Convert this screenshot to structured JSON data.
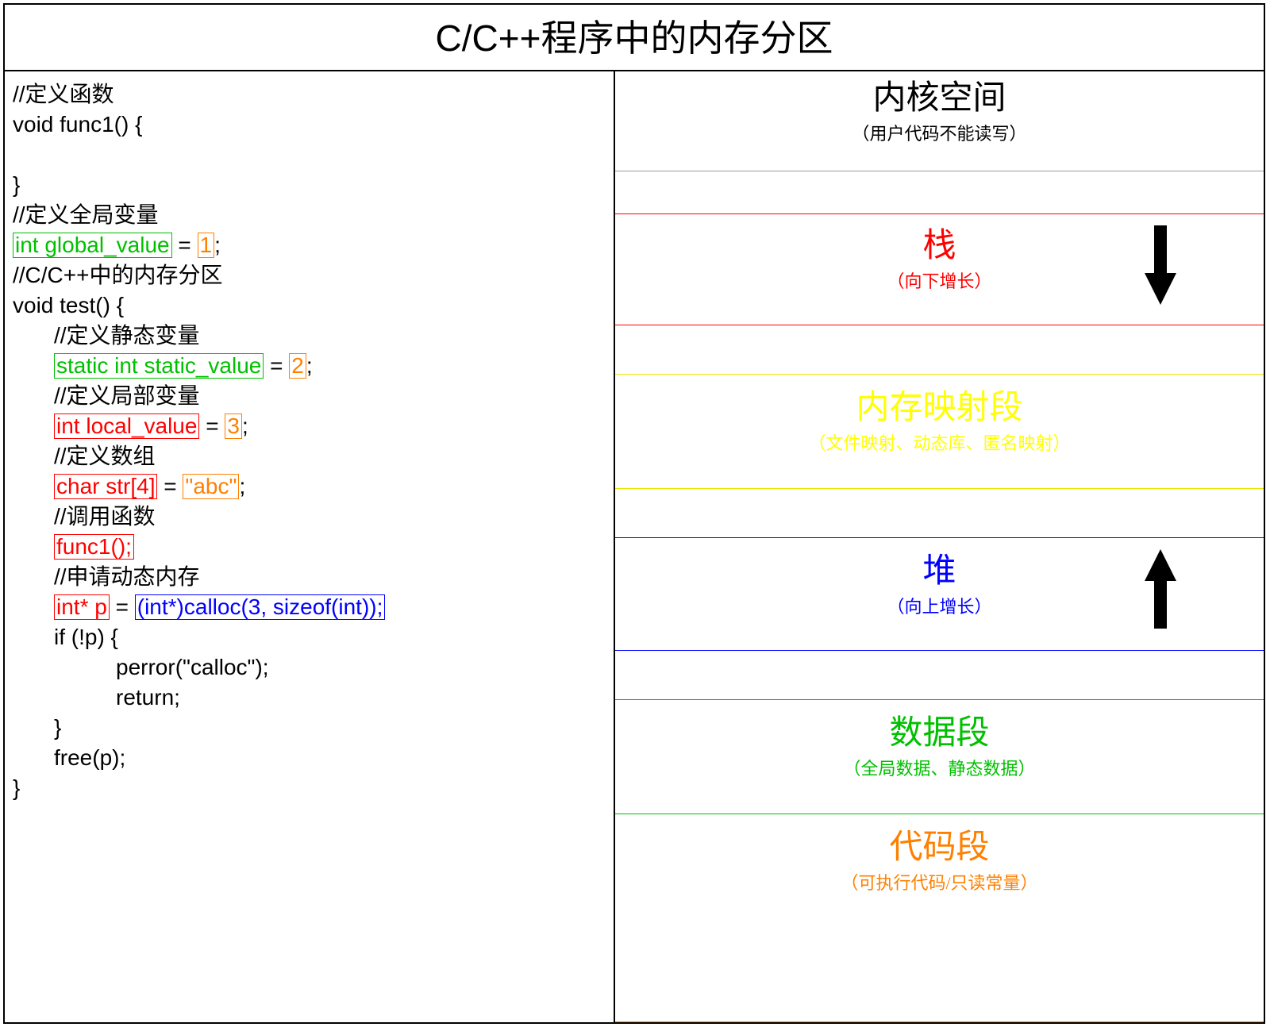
{
  "title": "C/C++程序中的内存分区",
  "code": {
    "c01": "//定义函数",
    "c02": "void func1() {",
    "c03": "}",
    "c04": "//定义全局变量",
    "c05_a": "int global_value",
    "c05_eq": " = ",
    "c05_b": "1",
    "c05_semi": ";",
    "c06": "//C/C++中的内存分区",
    "c07": "void test() {",
    "c08": "//定义静态变量",
    "c09_a": "static int static_value",
    "c09_eq": " = ",
    "c09_b": "2",
    "c09_semi": ";",
    "c10": "//定义局部变量",
    "c11_a": "int local_value",
    "c11_eq": " = ",
    "c11_b": "3",
    "c11_semi": ";",
    "c12": "//定义数组",
    "c13_a": "char str[4]",
    "c13_eq": " = ",
    "c13_b": "\"abc\"",
    "c13_semi": ";",
    "c14": "//调用函数",
    "c15_a": "func1();",
    "c16": "//申请动态内存",
    "c17_a": "int* p",
    "c17_eq": " = ",
    "c17_b": "(int*)calloc(3, sizeof(int));",
    "c18": "if (!p) {",
    "c19": "perror(\"calloc\");",
    "c20": "return;",
    "c21": "}",
    "c22": "free(p);",
    "c23": "}"
  },
  "mem": {
    "kernel_t": "内核空间",
    "kernel_s": "（用户代码不能读写）",
    "stack_t": "栈",
    "stack_s": "（向下增长）",
    "mmap_t": "内存映射段",
    "mmap_s": "（文件映射、动态库、匿名映射）",
    "heap_t": "堆",
    "heap_s": "（向上增长）",
    "data_t": "数据段",
    "data_s": "（全局数据、静态数据）",
    "code_t": "代码段",
    "code_s": "（可执行代码/只读常量）"
  },
  "colors": {
    "green": "#00c000",
    "orange": "#ff8000",
    "red": "#ff0000",
    "blue": "#0000ff",
    "yellow": "#ffff00"
  }
}
